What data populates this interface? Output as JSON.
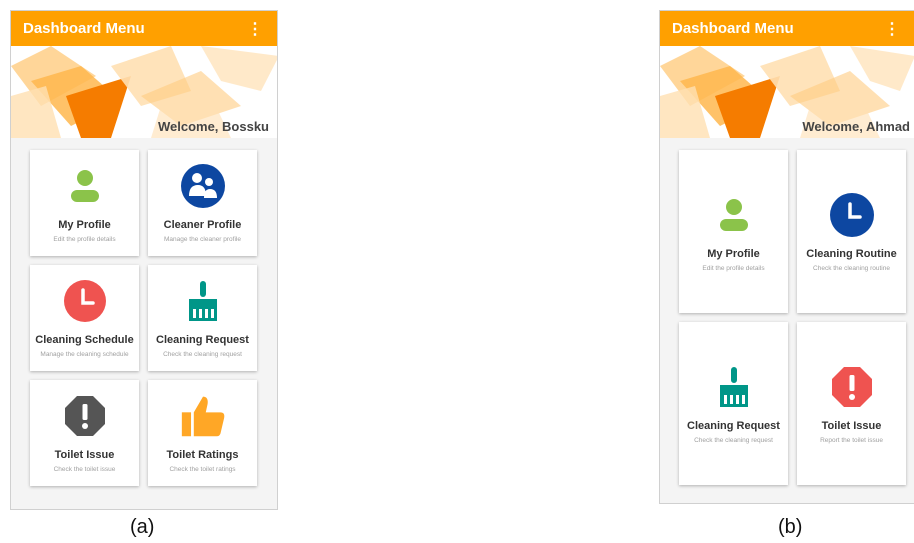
{
  "phone_a": {
    "caption": "(a)",
    "appbar_title": "Dashboard Menu",
    "menu_icon": "⋮",
    "welcome": "Welcome, Bossku",
    "cards": [
      {
        "title": "My Profile",
        "subtitle": "Edit the profile details",
        "icon": "person-icon",
        "color": "#8bc34a"
      },
      {
        "title": "Cleaner Profile",
        "subtitle": "Manage the cleaner profile",
        "icon": "people-icon",
        "color": "#0d47a1"
      },
      {
        "title": "Cleaning Schedule",
        "subtitle": "Manage the cleaning schedule",
        "icon": "clock-icon",
        "color": "#ef5350"
      },
      {
        "title": "Cleaning Request",
        "subtitle": "Check the cleaning request",
        "icon": "broom-icon",
        "color": "#009688"
      },
      {
        "title": "Toilet Issue",
        "subtitle": "Check the toilet issue",
        "icon": "alert-octagon-icon",
        "color": "#555555"
      },
      {
        "title": "Toilet Ratings",
        "subtitle": "Check the toilet ratings",
        "icon": "thumbs-up-icon",
        "color": "#ffa726"
      }
    ]
  },
  "phone_b": {
    "caption": "(b)",
    "appbar_title": "Dashboard Menu",
    "menu_icon": "⋮",
    "welcome": "Welcome, Ahmad",
    "cards": [
      {
        "title": "My Profile",
        "subtitle": "Edit the profile details",
        "icon": "person-icon",
        "color": "#8bc34a"
      },
      {
        "title": "Cleaning Routine",
        "subtitle": "Check the cleaning routine",
        "icon": "clock-icon",
        "color": "#0d47a1"
      },
      {
        "title": "Cleaning Request",
        "subtitle": "Check the cleaning request",
        "icon": "broom-icon",
        "color": "#009688"
      },
      {
        "title": "Toilet Issue",
        "subtitle": "Report the toilet issue",
        "icon": "alert-octagon-icon",
        "color": "#ef5350"
      }
    ]
  },
  "accent_colors": {
    "appbar": "#ffa000",
    "banner": "#f57c00"
  }
}
